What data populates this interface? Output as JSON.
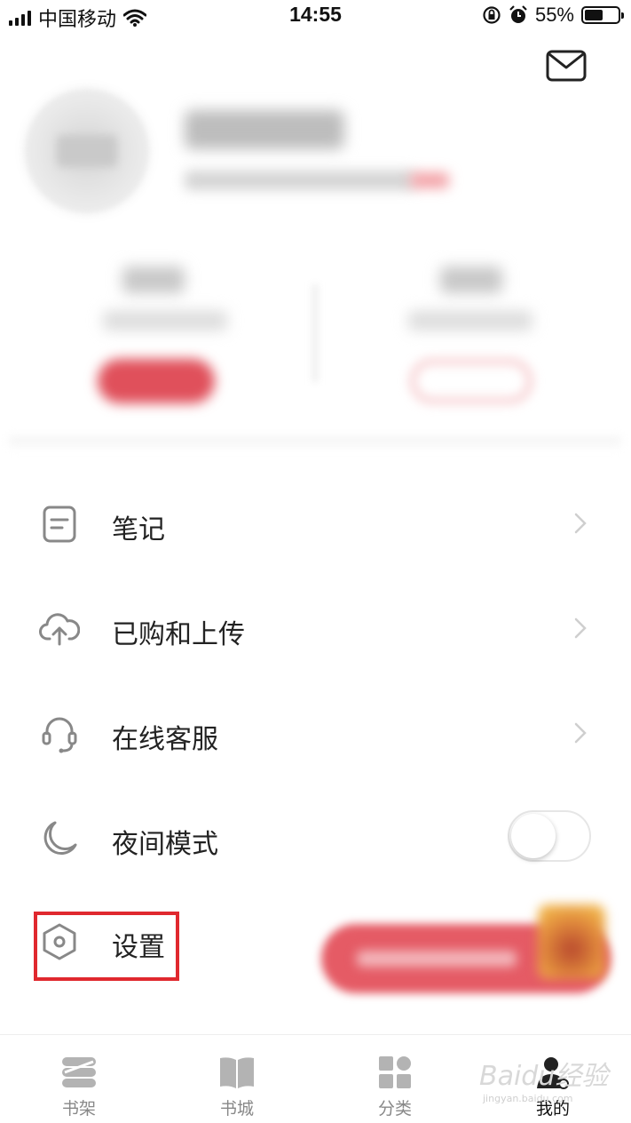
{
  "status_bar": {
    "carrier": "中国移动",
    "time": "14:55",
    "battery": "55%",
    "battery_level": 0.55
  },
  "menu": {
    "items": [
      {
        "label": "笔记",
        "icon": "note-icon",
        "chevron": true
      },
      {
        "label": "已购和上传",
        "icon": "cloud-upload-icon",
        "chevron": true
      },
      {
        "label": "在线客服",
        "icon": "headset-icon",
        "chevron": true
      },
      {
        "label": "夜间模式",
        "icon": "moon-icon",
        "toggle": false
      },
      {
        "label": "设置",
        "icon": "settings-hexagon-icon",
        "highlighted": true
      }
    ]
  },
  "tabs": [
    {
      "label": "书架",
      "icon": "bookshelf-icon",
      "active": false
    },
    {
      "label": "书城",
      "icon": "book-icon",
      "active": false
    },
    {
      "label": "分类",
      "icon": "category-icon",
      "active": false
    },
    {
      "label": "我的",
      "icon": "user-icon",
      "active": true
    }
  ],
  "colors": {
    "accent": "#e0505b",
    "highlight_box": "#e0282e",
    "text": "#222222",
    "icon": "#888888"
  },
  "watermark": {
    "brand": "Baidu经验",
    "url": "jingyan.baidu.com"
  }
}
